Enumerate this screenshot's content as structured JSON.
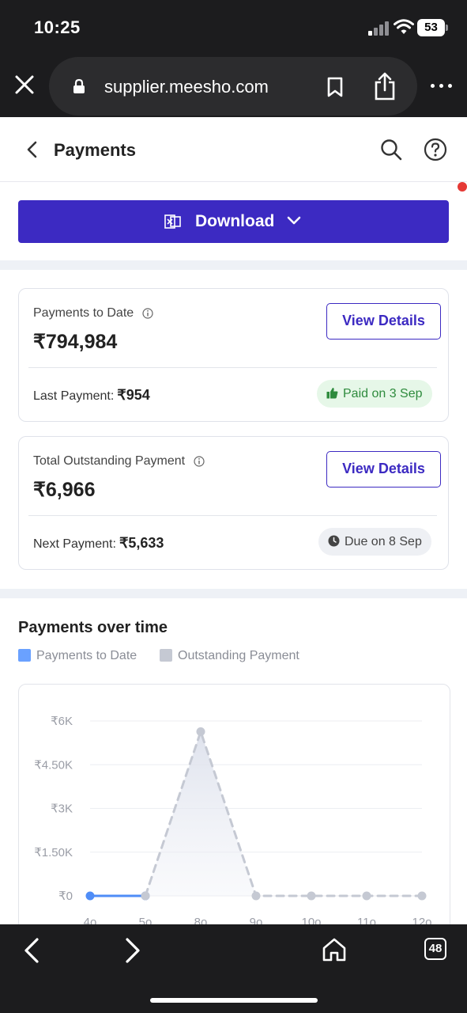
{
  "status_bar": {
    "time": "10:25",
    "battery": "53"
  },
  "browser": {
    "url": "supplier.meesho.com",
    "tab_count": "48"
  },
  "header": {
    "title": "Payments"
  },
  "download": {
    "label": "Download"
  },
  "payments_card": {
    "label": "Payments to Date",
    "amount": "₹794,984",
    "view_label": "View Details",
    "sub_label": "Last Payment:",
    "sub_amount": "₹954",
    "pill_label": "Paid on 3 Sep"
  },
  "outstanding_card": {
    "label": "Total Outstanding Payment",
    "amount": "₹6,966",
    "view_label": "View Details",
    "sub_label": "Next Payment:",
    "sub_amount": "₹5,633",
    "pill_label": "Due on 8 Sep"
  },
  "chart_section": {
    "title": "Payments over time",
    "legend": [
      {
        "label": "Payments to Date",
        "color": "#6aa1ff"
      },
      {
        "label": "Outstanding Payment",
        "color": "#c5c9d3"
      }
    ]
  },
  "chart_data": {
    "type": "line",
    "title": "Payments over time",
    "categories": [
      "4o",
      "5o",
      "8o",
      "9o",
      "10o",
      "11o",
      "12o"
    ],
    "y_tick_labels": [
      "₹6K",
      "₹4.50K",
      "₹3K",
      "₹1.50K",
      "₹0"
    ],
    "ylim": [
      0,
      6000
    ],
    "grid": true,
    "legend_position": "top-left",
    "series": [
      {
        "name": "Payments to Date",
        "color": "#4f8df7",
        "style": "solid",
        "points": [
          [
            0,
            0
          ],
          [
            1,
            0
          ]
        ]
      },
      {
        "name": "Outstanding Payment",
        "color": "#c5c9d3",
        "style": "dashed",
        "area": true,
        "points": [
          [
            1,
            0
          ],
          [
            2,
            5633
          ],
          [
            3,
            0
          ],
          [
            4,
            0
          ],
          [
            5,
            0
          ],
          [
            6,
            0
          ]
        ]
      }
    ]
  }
}
